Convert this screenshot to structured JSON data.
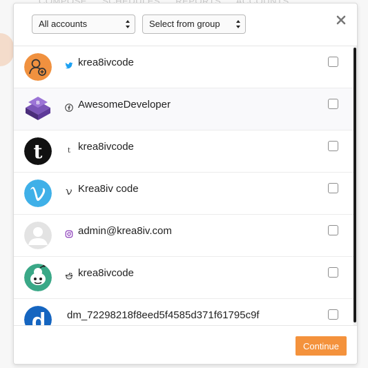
{
  "background": {
    "tabs": [
      "COMPOSE",
      "SCHEDULES",
      "REPORTS",
      "ACCOUNTS"
    ]
  },
  "header": {
    "accounts_select": {
      "selected": "All accounts"
    },
    "group_select": {
      "selected": "Select from group"
    }
  },
  "accounts": [
    {
      "service": "twitter",
      "name": "krea8ivcode",
      "checked": false,
      "avatar_color": "#f0913f"
    },
    {
      "service": "facebook",
      "name": "AwesomeDeveloper",
      "checked": false,
      "avatar_color": "#5b3d8c"
    },
    {
      "service": "tumblr",
      "name": "krea8ivcode",
      "checked": false,
      "avatar_color": "#111111"
    },
    {
      "service": "vimeo",
      "name": "Krea8iv code",
      "checked": false,
      "avatar_color": "#3fb0e8"
    },
    {
      "service": "instagram",
      "name": "admin@krea8iv.com",
      "checked": false,
      "avatar_color": "#dcdcdc"
    },
    {
      "service": "reddit",
      "name": "krea8ivcode",
      "checked": false,
      "avatar_color": "#3aa887"
    },
    {
      "service": "dailymotion",
      "name": "dm_72298218f8eed5f4585d371f61795c9f",
      "checked": false,
      "avatar_color": "#1565c0"
    }
  ],
  "footer": {
    "continue_label": "Continue"
  },
  "colors": {
    "accent": "#f4923c",
    "twitter": "#1da1f2",
    "facebook": "#3b5998",
    "instagram": "#8a3ab9"
  }
}
